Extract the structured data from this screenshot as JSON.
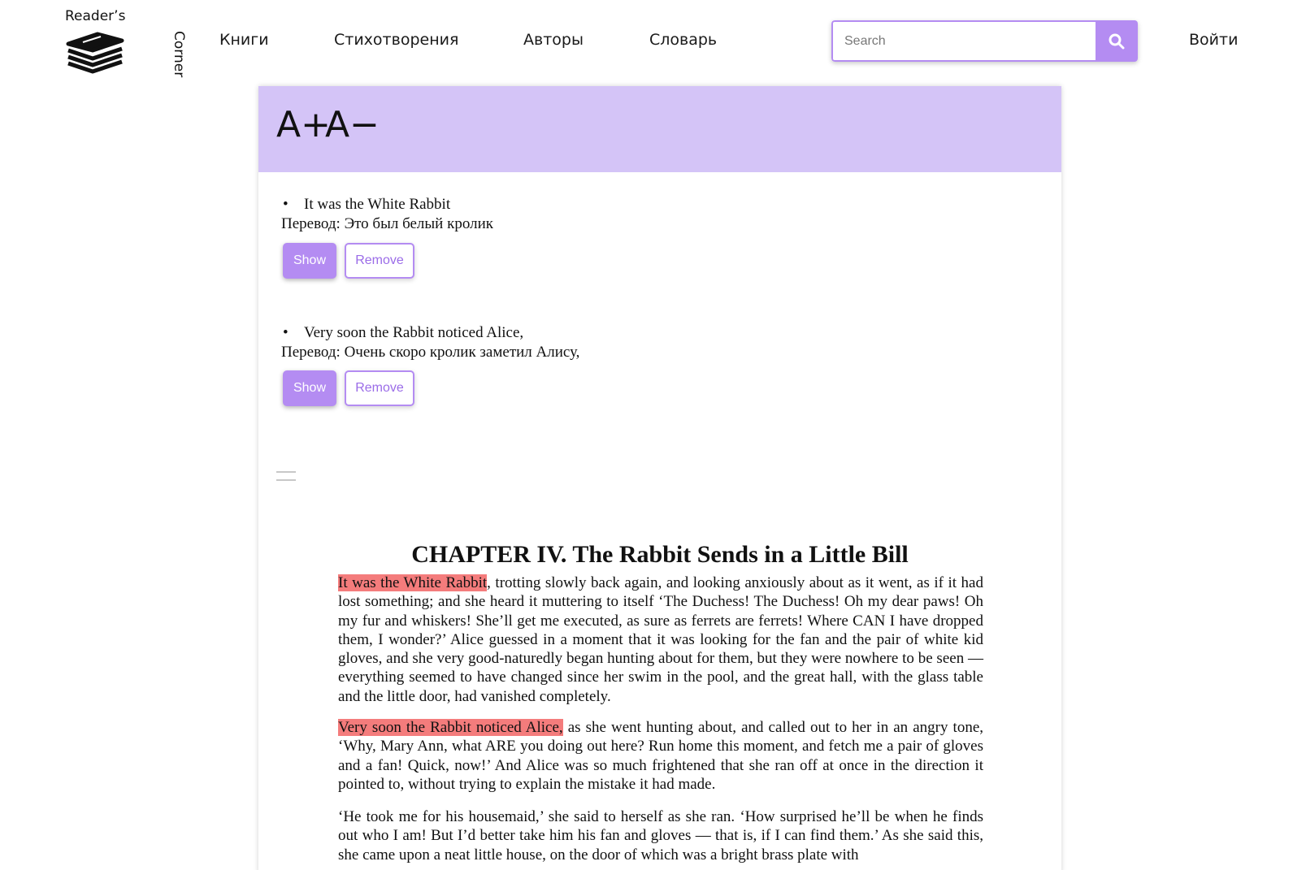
{
  "header": {
    "logo_top": "Reader’s",
    "logo_side": "Corner",
    "nav": [
      "Книги",
      "Стихотворения",
      "Авторы",
      "Словарь"
    ],
    "search_placeholder": "Search",
    "login_label": "Войти"
  },
  "font_controls": {
    "increase": "A+",
    "decrease": "A−"
  },
  "phrases": [
    {
      "text": "It was the White Rabbit",
      "translation": "Перевод: Это был белый кролик",
      "show_label": "Show",
      "remove_label": "Remove"
    },
    {
      "text": "Very soon the Rabbit noticed Alice,",
      "translation": "Перевод: Очень скоро кролик заметил Алису,",
      "show_label": "Show",
      "remove_label": "Remove"
    }
  ],
  "chapter": {
    "title": "CHAPTER IV. The Rabbit Sends in a Little Bill",
    "p1_highlight": "It was the White Rabbit",
    "p1_rest": ", trotting slowly back again, and looking anxiously about as it went, as if it had lost something; and she heard it muttering to itself ‘The Duchess! The Duchess! Oh my dear paws! Oh my fur and whiskers! She’ll get me executed, as sure as ferrets are ferrets! Where CAN I have dropped them, I wonder?’ Alice guessed in a moment that it was looking for the fan and the pair of white kid gloves, and she very good-naturedly began hunting about for them, but they were nowhere to be seen — everything seemed to have changed since her swim in the pool, and the great hall, with the glass table and the little door, had vanished completely.",
    "p2_highlight": "Very soon the Rabbit noticed Alice,",
    "p2_rest": " as she went hunting about, and called out to her in an angry tone, ‘Why, Mary Ann, what ARE you doing out here? Run home this moment, and fetch me a pair of gloves and a fan! Quick, now!’ And Alice was so much frightened that she ran off at once in the direction it pointed to, without trying to explain the mistake it had made.",
    "p3": "‘He took me for his housemaid,’ she said to herself as she ran. ‘How surprised he’ll be when he finds out who I am! But I’d better take him his fan and gloves — that is, if I can find them.’ As she said this, she came upon a neat little house, on the door of which was a bright brass plate with"
  },
  "colors": {
    "accent": "#b48cf2",
    "font_bar": "#d4c4f7",
    "highlight": "#f47c7c"
  }
}
